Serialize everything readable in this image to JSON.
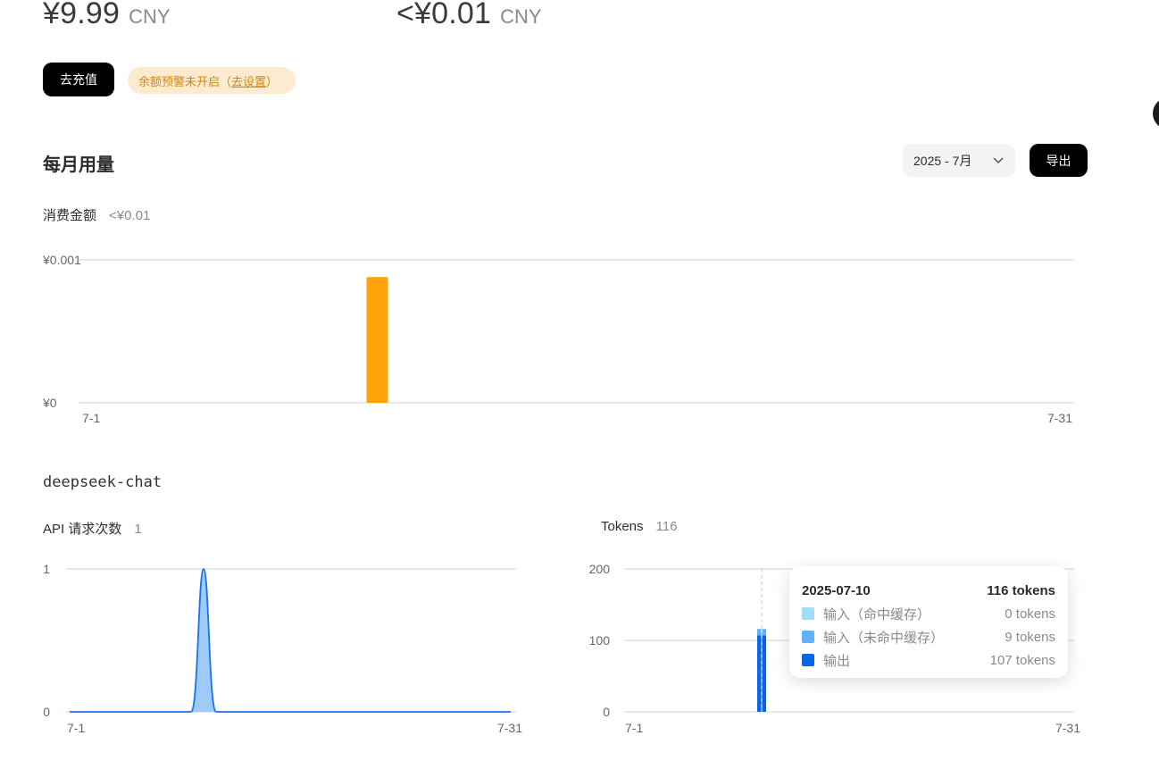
{
  "balance": {
    "left": {
      "amount": "¥9.99",
      "unit": "CNY"
    },
    "right": {
      "amount": "<¥0.01",
      "unit": "CNY"
    }
  },
  "actions": {
    "topup_label": "去充值",
    "alert_text": "余额预警未开启（",
    "alert_link": "去设置",
    "alert_close": "）"
  },
  "monthly": {
    "title": "每月用量",
    "month_select": "2025 - 7月",
    "export_label": "导出"
  },
  "spend": {
    "label": "消费金额",
    "value": "<¥0.01"
  },
  "model": {
    "name": "deepseek-chat",
    "requests_label": "API 请求次数",
    "requests_value": "1",
    "tokens_label": "Tokens",
    "tokens_value": "116"
  },
  "tooltip": {
    "date": "2025-07-10",
    "total": "116 tokens",
    "items": [
      {
        "label": "输入（命中缓存）",
        "value": "0 tokens",
        "color": "#a3dcfb"
      },
      {
        "label": "输入（未命中缓存）",
        "value": "9 tokens",
        "color": "#5fb2f7"
      },
      {
        "label": "输出",
        "value": "107 tokens",
        "color": "#0a64e6"
      }
    ]
  },
  "chart_data": [
    {
      "type": "bar",
      "title": "消费金额",
      "x": [
        "7-10"
      ],
      "values": [
        0.00088
      ],
      "color": "#ffa10a",
      "yticks": [
        "¥0",
        "¥0.001"
      ],
      "ylim": [
        0,
        0.001
      ],
      "xticks": [
        "7-1",
        "7-31"
      ],
      "xlim": [
        1,
        31
      ],
      "grid": true
    },
    {
      "type": "area",
      "title": "API 请求次数",
      "x": [
        "7-10"
      ],
      "values": [
        1
      ],
      "color": "#1874e8",
      "yticks": [
        "0",
        "1"
      ],
      "ylim": [
        0,
        1
      ],
      "xticks": [
        "7-1",
        "7-31"
      ],
      "xlim": [
        1,
        31
      ],
      "grid": true
    },
    {
      "type": "bar",
      "title": "Tokens",
      "x": [
        "7-10"
      ],
      "series": [
        {
          "name": "输入（命中缓存）",
          "values": [
            0
          ],
          "color": "#a3dcfb"
        },
        {
          "name": "输入（未命中缓存）",
          "values": [
            9
          ],
          "color": "#5fb2f7"
        },
        {
          "name": "输出",
          "values": [
            107
          ],
          "color": "#0a64e6"
        }
      ],
      "stacked": true,
      "yticks": [
        "0",
        "100",
        "200"
      ],
      "ylim": [
        0,
        200
      ],
      "xticks": [
        "7-1",
        "7-31"
      ],
      "xlim": [
        1,
        31
      ],
      "grid": true
    }
  ]
}
